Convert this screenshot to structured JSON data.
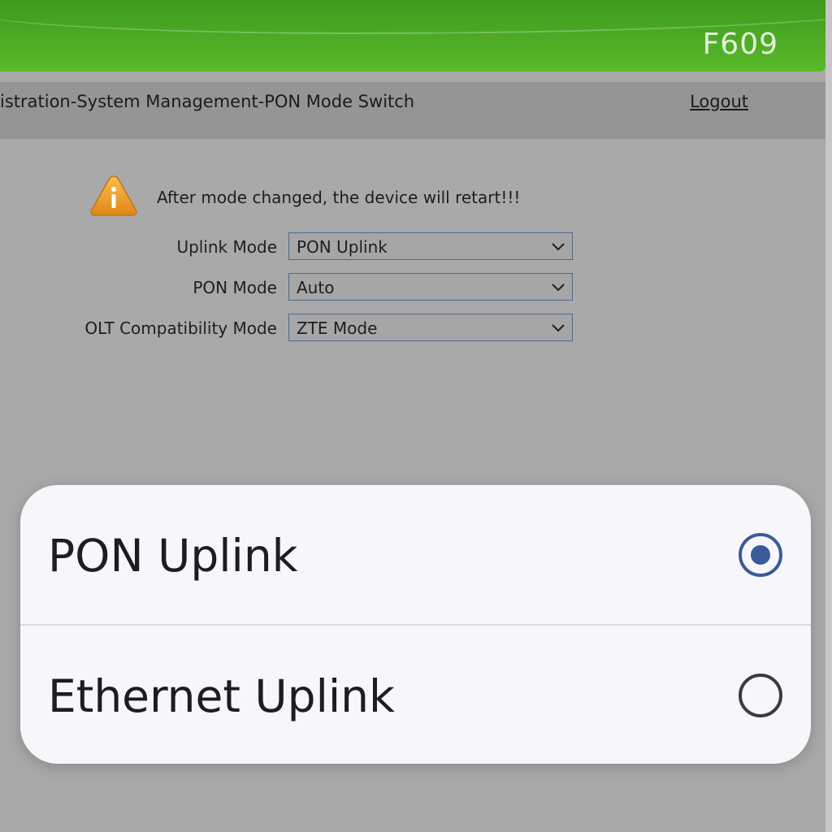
{
  "header": {
    "model": "F609"
  },
  "nav": {
    "breadcrumb": "istration-System Management-PON Mode Switch",
    "logout_label": "Logout"
  },
  "warning": {
    "icon": "warning-icon",
    "message": "After mode changed, the device will retart!!!"
  },
  "form": {
    "uplink_mode": {
      "label": "Uplink Mode",
      "value": "PON Uplink"
    },
    "pon_mode": {
      "label": "PON Mode",
      "value": "Auto"
    },
    "olt_mode": {
      "label": "OLT Compatibility Mode",
      "value": "ZTE Mode"
    }
  },
  "picker": {
    "options": [
      {
        "label": "PON Uplink",
        "selected": true
      },
      {
        "label": "Ethernet Uplink",
        "selected": false
      }
    ]
  },
  "colors": {
    "header_green": "#4aa824",
    "radio_accent": "#3a5a99",
    "warning_orange": "#f0a020"
  }
}
